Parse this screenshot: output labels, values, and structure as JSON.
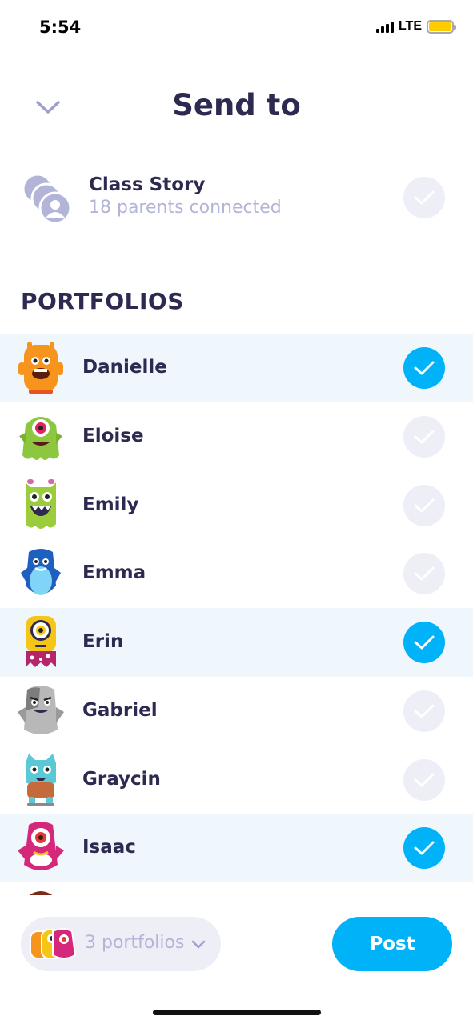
{
  "status_bar": {
    "time": "5:54",
    "network": "LTE"
  },
  "header": {
    "title": "Send to"
  },
  "class_story": {
    "title": "Class Story",
    "subtitle": "18 parents connected",
    "selected": false
  },
  "portfolios": {
    "section_title": "PORTFOLIOS",
    "students": [
      {
        "name": "Danielle",
        "selected": true,
        "avatar": "orange-monster-icon"
      },
      {
        "name": "Eloise",
        "selected": false,
        "avatar": "green-one-eyed-monster-icon"
      },
      {
        "name": "Emily",
        "selected": false,
        "avatar": "lime-monster-icon"
      },
      {
        "name": "Emma",
        "selected": false,
        "avatar": "blue-penguin-monster-icon"
      },
      {
        "name": "Erin",
        "selected": true,
        "avatar": "yellow-one-eyed-monster-icon"
      },
      {
        "name": "Gabriel",
        "selected": false,
        "avatar": "gray-monster-icon"
      },
      {
        "name": "Graycin",
        "selected": false,
        "avatar": "teal-cat-monster-icon"
      },
      {
        "name": "Isaac",
        "selected": true,
        "avatar": "pink-one-eyed-monster-icon"
      }
    ]
  },
  "bottom_bar": {
    "portfolio_count_label": "3 portfolios",
    "post_label": "Post"
  },
  "colors": {
    "accent": "#00b2f7",
    "title_text": "#2c2a50",
    "muted_text": "#b3b5d8",
    "selected_row": "#eff7fd",
    "unchecked": "#eeeff6"
  }
}
